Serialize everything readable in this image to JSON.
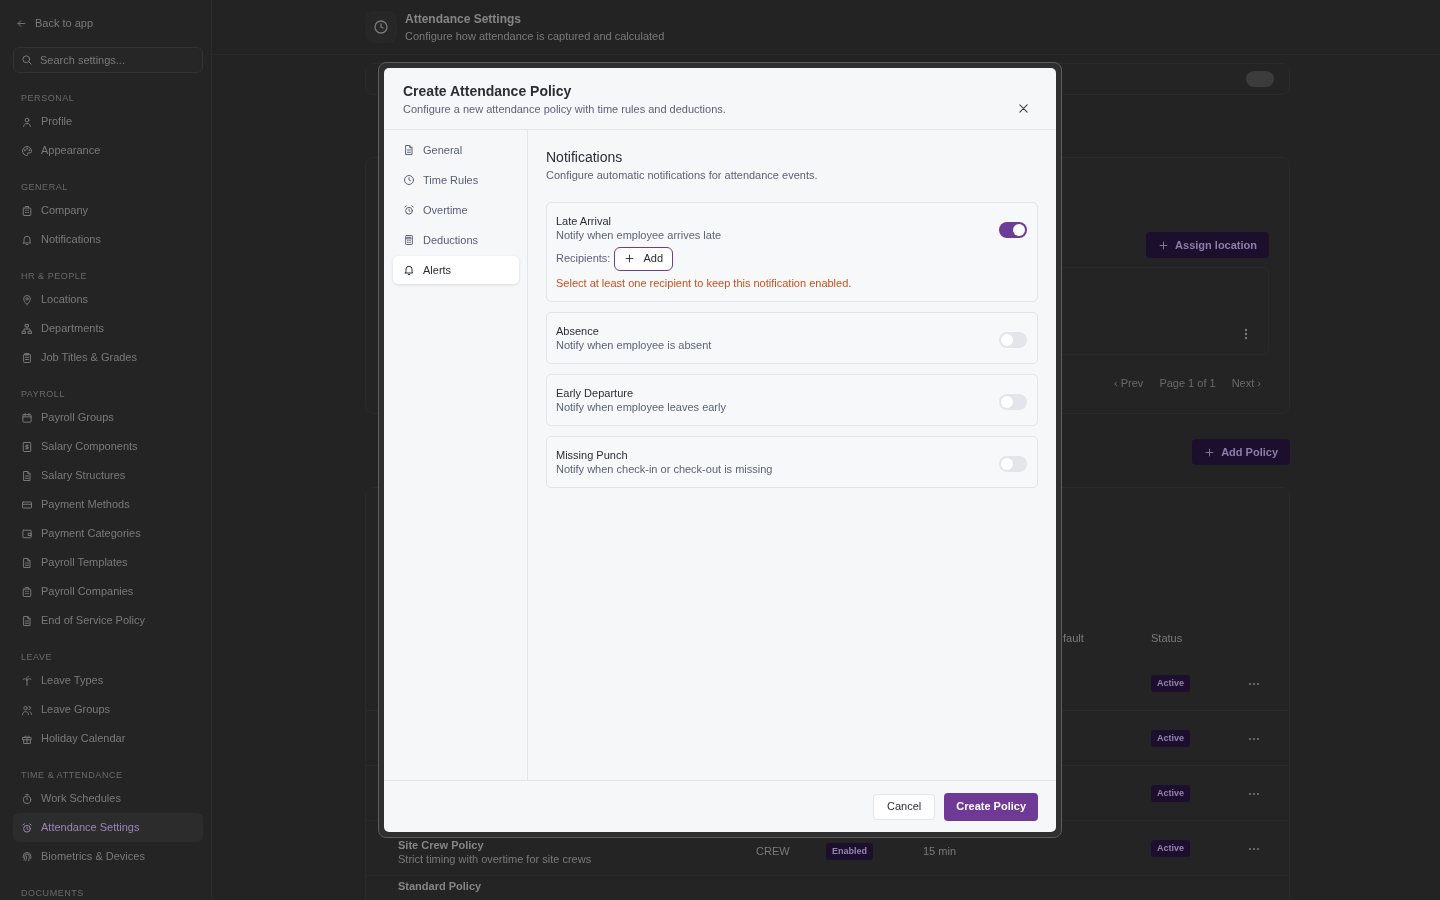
{
  "sidebar": {
    "back_link": "Back to app",
    "search": {
      "placeholder": "Search settings..."
    },
    "sections": [
      {
        "title": "PERSONAL",
        "items": [
          {
            "label": "Profile",
            "selected": false
          },
          {
            "label": "Appearance",
            "selected": false
          }
        ]
      },
      {
        "title": "GENERAL",
        "items": [
          {
            "label": "Company",
            "selected": false
          },
          {
            "label": "Notifications",
            "selected": false
          }
        ]
      },
      {
        "title": "HR & PEOPLE",
        "items": [
          {
            "label": "Locations",
            "selected": false
          },
          {
            "label": "Departments",
            "selected": false
          },
          {
            "label": "Job Titles & Grades",
            "selected": false
          }
        ]
      },
      {
        "title": "PAYROLL",
        "items": [
          {
            "label": "Payroll Groups",
            "selected": false
          },
          {
            "label": "Salary Components",
            "selected": false
          },
          {
            "label": "Salary Structures",
            "selected": false
          },
          {
            "label": "Payment Methods",
            "selected": false
          },
          {
            "label": "Payment Categories",
            "selected": false
          },
          {
            "label": "Payroll Templates",
            "selected": false
          },
          {
            "label": "Payroll Companies",
            "selected": false
          },
          {
            "label": "End of Service Policy",
            "selected": false
          }
        ]
      },
      {
        "title": "LEAVE",
        "items": [
          {
            "label": "Leave Types",
            "selected": false
          },
          {
            "label": "Leave Groups",
            "selected": false
          },
          {
            "label": "Holiday Calendar",
            "selected": false
          }
        ]
      },
      {
        "title": "TIME & ATTENDANCE",
        "items": [
          {
            "label": "Work Schedules",
            "selected": false
          },
          {
            "label": "Attendance Settings",
            "selected": true
          },
          {
            "label": "Biometrics & Devices",
            "selected": false
          }
        ]
      },
      {
        "title": "DOCUMENTS"
      }
    ]
  },
  "page_header": {
    "title": "Attendance Settings",
    "subtitle": "Configure how attendance is captured and calculated"
  },
  "require_approval_toggle": {
    "on": false
  },
  "locations_card": {
    "assign_button": "Assign location",
    "pagination": {
      "prev": "‹ Prev",
      "page": "Page 1 of 1",
      "next": "Next ›"
    }
  },
  "add_policy_button": "Add Policy",
  "policies_table": {
    "columns": [
      "fault",
      "Status"
    ],
    "rows": [
      {
        "status": "Active"
      },
      {
        "status": "Active"
      },
      {
        "status": "Active"
      },
      {
        "name": "Site Crew Policy",
        "description": "Strict timing with overtime for site crews",
        "column_2": "CREW",
        "column_3": "Enabled",
        "column_4": "15 min",
        "status": "Active"
      },
      {
        "name": "Standard Policy"
      }
    ]
  },
  "dialog": {
    "title": "Create Attendance Policy",
    "subtitle": "Configure a new attendance policy with time rules and deductions.",
    "nav": [
      {
        "label": "General",
        "selected": false
      },
      {
        "label": "Time Rules",
        "selected": false
      },
      {
        "label": "Overtime",
        "selected": false
      },
      {
        "label": "Deductions",
        "selected": false
      },
      {
        "label": "Alerts",
        "selected": true
      }
    ],
    "section_title": "Notifications",
    "section_subtitle": "Configure automatic notifications for attendance events.",
    "notifications": [
      {
        "title": "Late Arrival",
        "description": "Notify when employee arrives late",
        "on": true,
        "recipients_label": "Recipients:",
        "add_button": "Add",
        "error": "Select at least one recipient to keep this notification enabled."
      },
      {
        "title": "Absence",
        "description": "Notify when employee is absent",
        "on": false
      },
      {
        "title": "Early Departure",
        "description": "Notify when employee leaves early",
        "on": false
      },
      {
        "title": "Missing Punch",
        "description": "Notify when check-in or check-out is missing",
        "on": false
      }
    ],
    "cancel_button": "Cancel",
    "create_button": "Create Policy"
  }
}
